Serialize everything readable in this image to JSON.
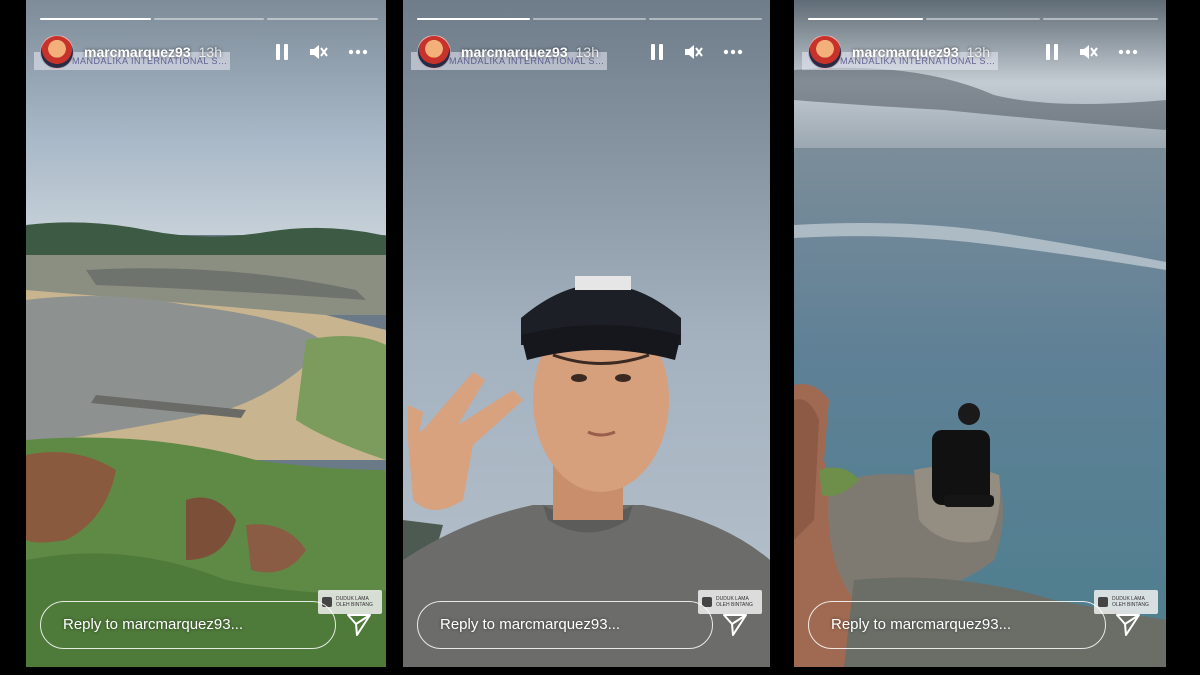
{
  "stories": [
    {
      "username": "marcmarquez93",
      "time": "13h",
      "location": "MANDALIKA INTERNATIONAL STREET CI...",
      "reply_placeholder": "Reply to marcmarquez93...",
      "progress": [
        1.0,
        0.0,
        0.0
      ],
      "sticker_text": "DUDUK LAMA OLEH BINTANG"
    },
    {
      "username": "marcmarquez93",
      "time": "13h",
      "location": "MANDALIKA INTERNATIONAL STREET CI...",
      "reply_placeholder": "Reply to marcmarquez93...",
      "progress": [
        1.0,
        0.0,
        0.0
      ],
      "sticker_text": "DUDUK LAMA OLEH BINTANG"
    },
    {
      "username": "marcmarquez93",
      "time": "13h",
      "location": "MANDALIKA INTERNATIONAL STREET CI...",
      "reply_placeholder": "Reply to marcmarquez93...",
      "progress": [
        1.0,
        0.0,
        0.0
      ],
      "sticker_text": "DUDUK LAMA OLEH BINTANG"
    }
  ],
  "icons": {
    "pause": "pause-icon",
    "mute": "volume-muted-icon",
    "more": "more-options-icon",
    "send": "send-icon"
  },
  "colors": {
    "background": "#000000",
    "text": "#ffffff"
  }
}
